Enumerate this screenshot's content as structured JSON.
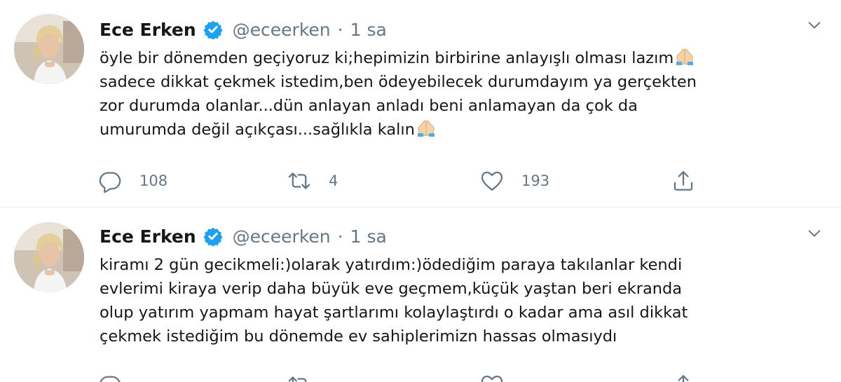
{
  "tweets": [
    {
      "display_name": "Ece Erken",
      "handle": "@eceerken",
      "separator": "·",
      "time": "1 sa",
      "lines": [
        "öyle bir dönemden geçiyoruz ki;hepimizin birbirine anlayışlı olması lazım",
        "sadece dikkat çekmek istedim,ben ödeyebilecek durumdayım ya gerçekten",
        "zor durumda olanlar...dün anlayan anladı beni anlamayan da çok da",
        "umurumda değil açıkçası...sağlıkla kalın"
      ],
      "reply_count": "108",
      "retweet_count": "4",
      "like_count": "193"
    },
    {
      "display_name": "Ece Erken",
      "handle": "@eceerken",
      "separator": "·",
      "time": "1 sa",
      "lines": [
        "kiramı 2 gün gecikmeli:)olarak yatırdım:)ödediğim paraya takılanlar kendi",
        "evlerimi kiraya verip daha büyük eve geçmem,küçük yaştan beri ekranda",
        "olup yatırım yapmam hayat şartlarımı kolaylaştırdı o kadar ama asıl dikkat",
        "çekmek istediğim bu dönemde ev sahiplerimizn hassas olmasıydı"
      ]
    }
  ],
  "icons": {
    "verified": "verified-badge-icon",
    "caret": "chevron-down-icon",
    "reply": "reply-icon",
    "retweet": "retweet-icon",
    "like": "heart-icon",
    "share": "share-icon",
    "emoji": "folded-hands-emoji"
  },
  "colors": {
    "name": "#14171a",
    "secondary": "#657786",
    "verified": "#1da1f2",
    "divider": "#e6ecf0"
  }
}
